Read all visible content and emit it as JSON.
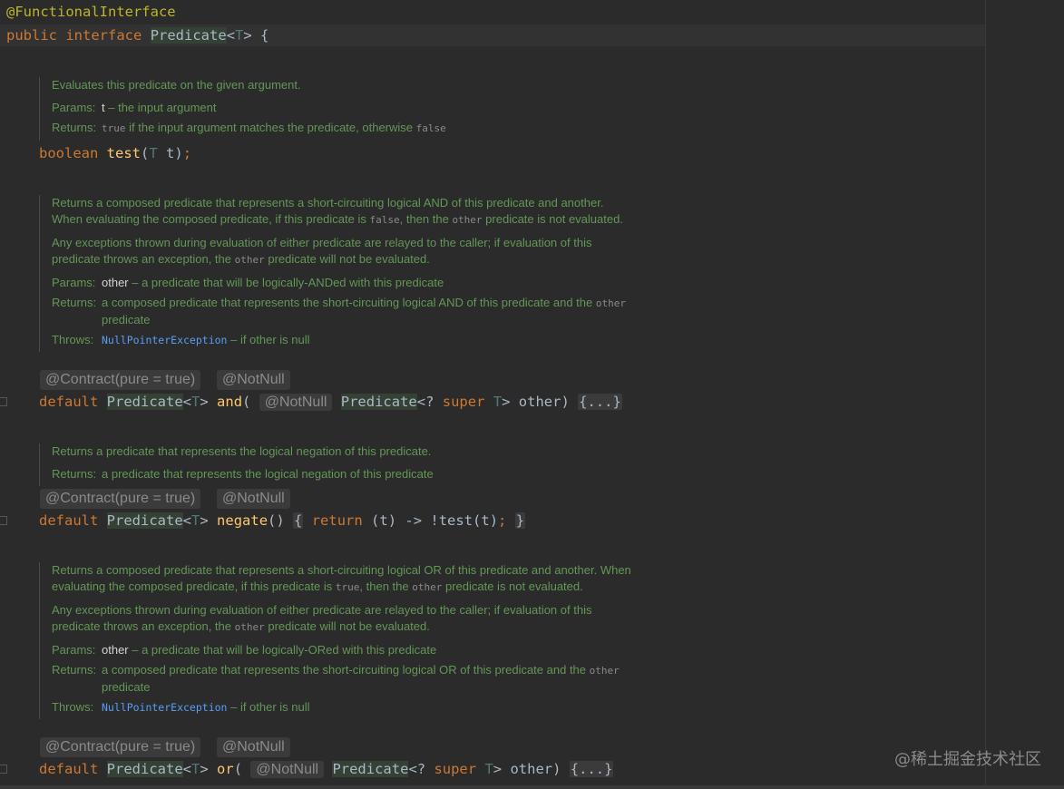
{
  "header": {
    "annotation": "@FunctionalInterface",
    "kw_public": "public",
    "kw_interface": "interface",
    "name": "Predicate",
    "open": "<",
    "tparam": "T",
    "close": "> {"
  },
  "docs": {
    "test": {
      "summary": "Evaluates this predicate on the given argument.",
      "params_label": "Params:",
      "params_name": "t",
      "params_text": " – the input argument",
      "returns_label": "Returns:",
      "returns_code1": "true",
      "returns_text": " if the input argument matches the predicate, otherwise ",
      "returns_code2": "false"
    },
    "and": {
      "p1_a": "Returns a composed predicate that represents a short-circuiting logical AND of this predicate and another. When evaluating the composed predicate, if this predicate is ",
      "p1_code1": "false",
      "p1_b": ", then the ",
      "p1_code2": "other",
      "p1_c": " predicate is not evaluated.",
      "p2_a": "Any exceptions thrown during evaluation of either predicate are relayed to the caller; if evaluation of this predicate throws an exception, the ",
      "p2_code": "other",
      "p2_b": " predicate will not be evaluated.",
      "params_label": "Params:",
      "params_name": "other",
      "params_text": " – a predicate that will be logically-ANDed with this predicate",
      "returns_label": "Returns:",
      "returns_a": "a composed predicate that represents the short-circuiting logical AND of this predicate and the ",
      "returns_code": "other",
      "returns_b": " predicate",
      "throws_label": "Throws:",
      "throws_link": "NullPointerException",
      "throws_text": " – if other is null"
    },
    "negate": {
      "summary": "Returns a predicate that represents the logical negation of this predicate.",
      "returns_label": "Returns:",
      "returns_text": "a predicate that represents the logical negation of this predicate"
    },
    "or": {
      "p1_a": "Returns a composed predicate that represents a short-circuiting logical OR of this predicate and another. When evaluating the composed predicate, if this predicate is ",
      "p1_code1": "true",
      "p1_b": ", then the ",
      "p1_code2": "other",
      "p1_c": " predicate is not evaluated.",
      "p2_a": "Any exceptions thrown during evaluation of either predicate are relayed to the caller; if evaluation of this predicate throws an exception, the ",
      "p2_code": "other",
      "p2_b": " predicate will not be evaluated.",
      "params_label": "Params:",
      "params_name": "other",
      "params_text": " – a predicate that will be logically-ORed with this predicate",
      "returns_label": "Returns:",
      "returns_a": "a composed predicate that represents the short-circuiting logical OR of this predicate and the ",
      "returns_code": "other",
      "returns_b": " predicate",
      "throws_label": "Throws:",
      "throws_link": "NullPointerException",
      "throws_text": " – if other is null"
    }
  },
  "inlays": {
    "contract": "@Contract(pure = true)",
    "notnull": "@NotNull"
  },
  "code": {
    "test": {
      "kw": "boolean",
      "fn": "test",
      "open": "(",
      "tp": "T",
      "rest": " t)",
      "semi": ";"
    },
    "and": {
      "kw": "default",
      "type": "Predicate",
      "lt": "<",
      "tp": "T",
      "gt": "> ",
      "fn": "and",
      "paren": "(",
      "ptype": "Predicate",
      "wild": "<? ",
      "super": "super",
      "tp2": "T",
      "rest": "> other) ",
      "fold": "{...}"
    },
    "negate": {
      "kw": "default",
      "type": "Predicate",
      "lt": "<",
      "tp": "T",
      "gt": "> ",
      "fn": "negate",
      "paren": "() ",
      "b1": "{",
      "ret": "return",
      "body": " (t) -> !test(t)",
      "semi": ";",
      "b2": "}"
    },
    "or": {
      "kw": "default",
      "type": "Predicate",
      "lt": "<",
      "tp": "T",
      "gt": "> ",
      "fn": "or",
      "paren": "(",
      "ptype": "Predicate",
      "wild": "<? ",
      "super": "super",
      "tp2": "T",
      "rest": "> other) ",
      "fold": "{...}"
    }
  },
  "watermark": "@稀土掘金技术社区"
}
